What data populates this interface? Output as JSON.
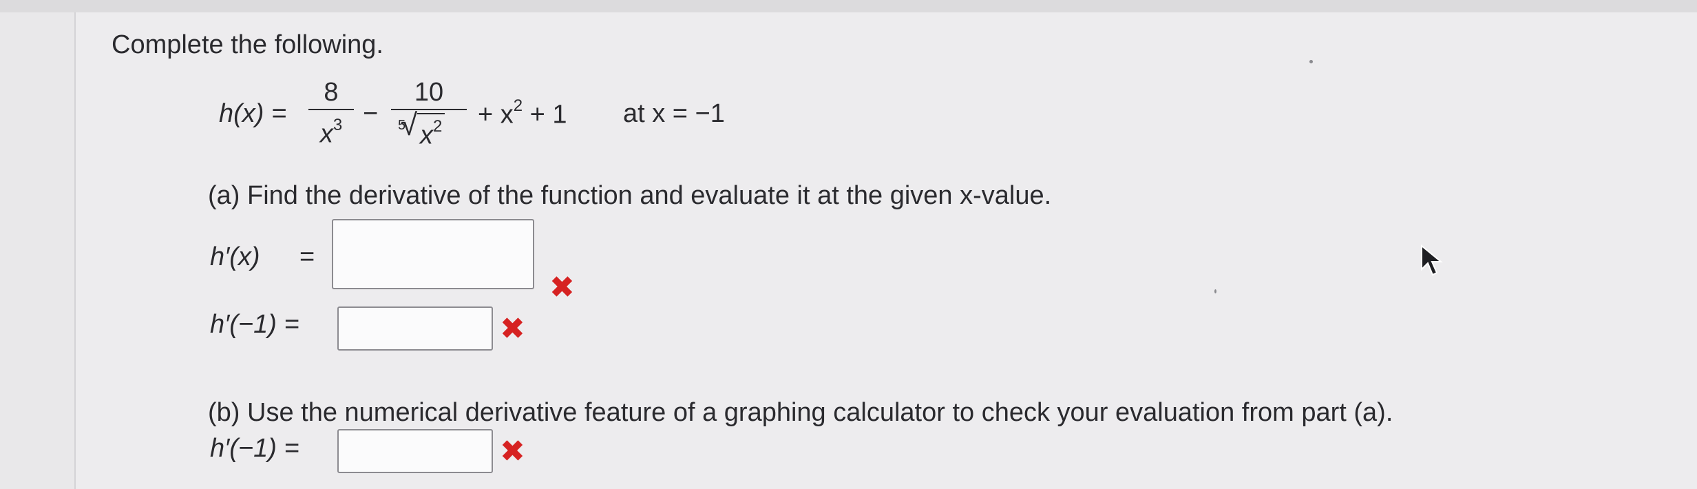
{
  "problem": {
    "instruction": "Complete the following.",
    "function_lhs": "h(x) =",
    "term1_num": "8",
    "term1_den_base": "x",
    "term1_den_exp": "3",
    "minus": "−",
    "term2_num": "10",
    "term2_root_index": "5",
    "term2_radicand_base": "x",
    "term2_radicand_exp": "2",
    "tail_plus1": "+ x",
    "tail_exp": "2",
    "tail_rest": "+ 1",
    "at_value": "at x = −1"
  },
  "part_a": {
    "prompt": "(a) Find the derivative of the function and evaluate it at the given x-value.",
    "deriv_label": "h′(x)",
    "deriv_eq": "=",
    "eval_label": "h′(−1) =",
    "deriv_value": "",
    "eval_value": "",
    "status_icon": "incorrect-x-icon"
  },
  "part_b": {
    "prompt": "(b) Use the numerical derivative feature of a graphing calculator to check your evaluation from part (a).",
    "eval_label": "h′(−1) =",
    "eval_value": "",
    "status_icon": "incorrect-x-icon"
  },
  "colors": {
    "incorrect": "#d62222",
    "text": "#2a2a2e",
    "background": "#edecee"
  }
}
